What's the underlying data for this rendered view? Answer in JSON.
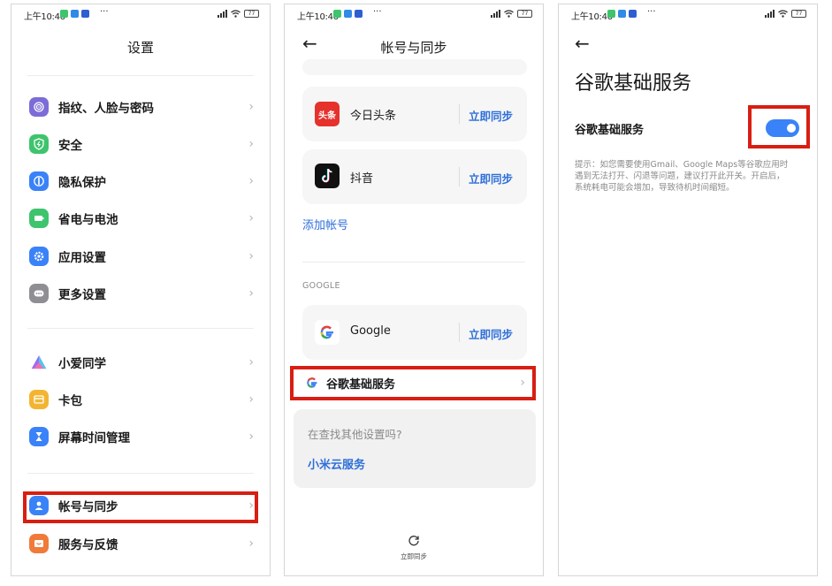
{
  "status_bar": {
    "time": "上午10:46",
    "dots": "···",
    "battery": "77"
  },
  "panel1": {
    "title": "设置",
    "items": [
      {
        "label": "指纹、人脸与密码",
        "icon": "fingerprint-icon",
        "color": "#7b6cd8"
      },
      {
        "label": "安全",
        "icon": "security-shield-icon",
        "color": "#3ec46d"
      },
      {
        "label": "隐私保护",
        "icon": "privacy-icon",
        "color": "#3a82f7"
      },
      {
        "label": "省电与电池",
        "icon": "battery-icon",
        "color": "#3ec46d"
      },
      {
        "label": "应用设置",
        "icon": "app-settings-gear-icon",
        "color": "#3a82f7"
      },
      {
        "label": "更多设置",
        "icon": "more-settings-icon",
        "color": "#8e8e93"
      },
      {
        "label": "小爱同学",
        "icon": "xiaoai-assistant-icon",
        "color": "#9b6cf0"
      },
      {
        "label": "卡包",
        "icon": "card-wallet-icon",
        "color": "#f3b531"
      },
      {
        "label": "屏幕时间管理",
        "icon": "hourglass-icon",
        "color": "#3a82f7"
      },
      {
        "label": "帐号与同步",
        "icon": "account-user-icon",
        "color": "#3a82f7"
      },
      {
        "label": "服务与反馈",
        "icon": "feedback-icon",
        "color": "#f07a3a"
      }
    ]
  },
  "panel2": {
    "title": "帐号与同步",
    "apps": [
      {
        "name": "今日头条",
        "logo_text": "头条",
        "sync": "立即同步"
      },
      {
        "name": "抖音",
        "sync": "立即同步"
      },
      {
        "name": "Google",
        "sync": "立即同步"
      }
    ],
    "add_account": "添加帐号",
    "section_google": "GOOGLE",
    "google_service": "谷歌基础服务",
    "help_question": "在查找其他设置吗?",
    "help_link": "小米云服务",
    "sync_now": "立即同步"
  },
  "panel3": {
    "title": "谷歌基础服务",
    "setting_label": "谷歌基础服务",
    "toggle_on": true,
    "tip": "提示：如您需要使用Gmail、Google Maps等谷歌应用时遇到无法打开、闪退等问题，建议打开此开关。开启后，系统耗电可能会增加，导致待机时间缩短。"
  },
  "colors": {
    "highlight": "#d81e12",
    "link_blue": "#2e6fd9",
    "toggle_blue": "#3a82f7"
  }
}
